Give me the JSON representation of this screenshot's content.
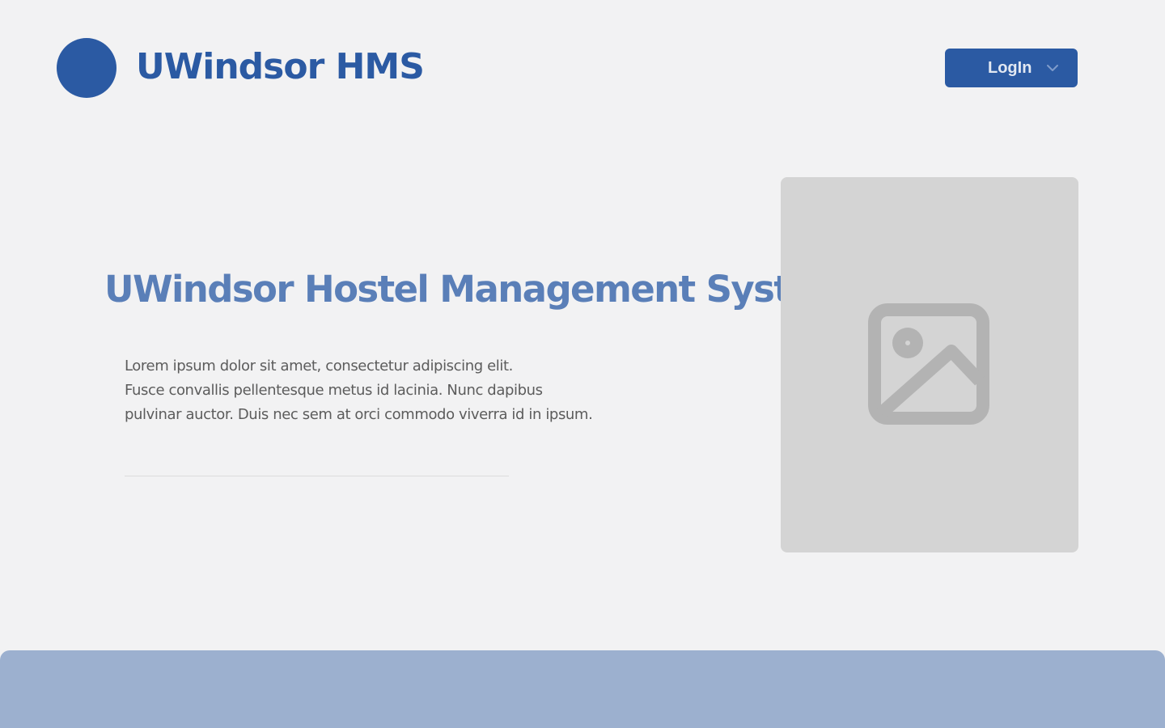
{
  "header": {
    "brand": "UWindsor HMS",
    "login_label": "LogIn",
    "login_icon": "chevron-down-icon"
  },
  "hero": {
    "title": "UWindsor Hostel Management System",
    "description_lines": [
      "Lorem ipsum dolor sit amet, consectetur adipiscing elit.",
      "Fusce convallis pellentesque metus id lacinia. Nunc dapibus",
      "pulvinar auctor. Duis nec sem at orci commodo viverra id in ipsum."
    ],
    "image_icon": "image-placeholder-icon"
  },
  "colors": {
    "brand": "#2b5aa3",
    "hero_title": "#5a7fb8",
    "background": "#f2f2f3",
    "image_card": "#d4d4d4",
    "footer": "#9cb0cf"
  }
}
